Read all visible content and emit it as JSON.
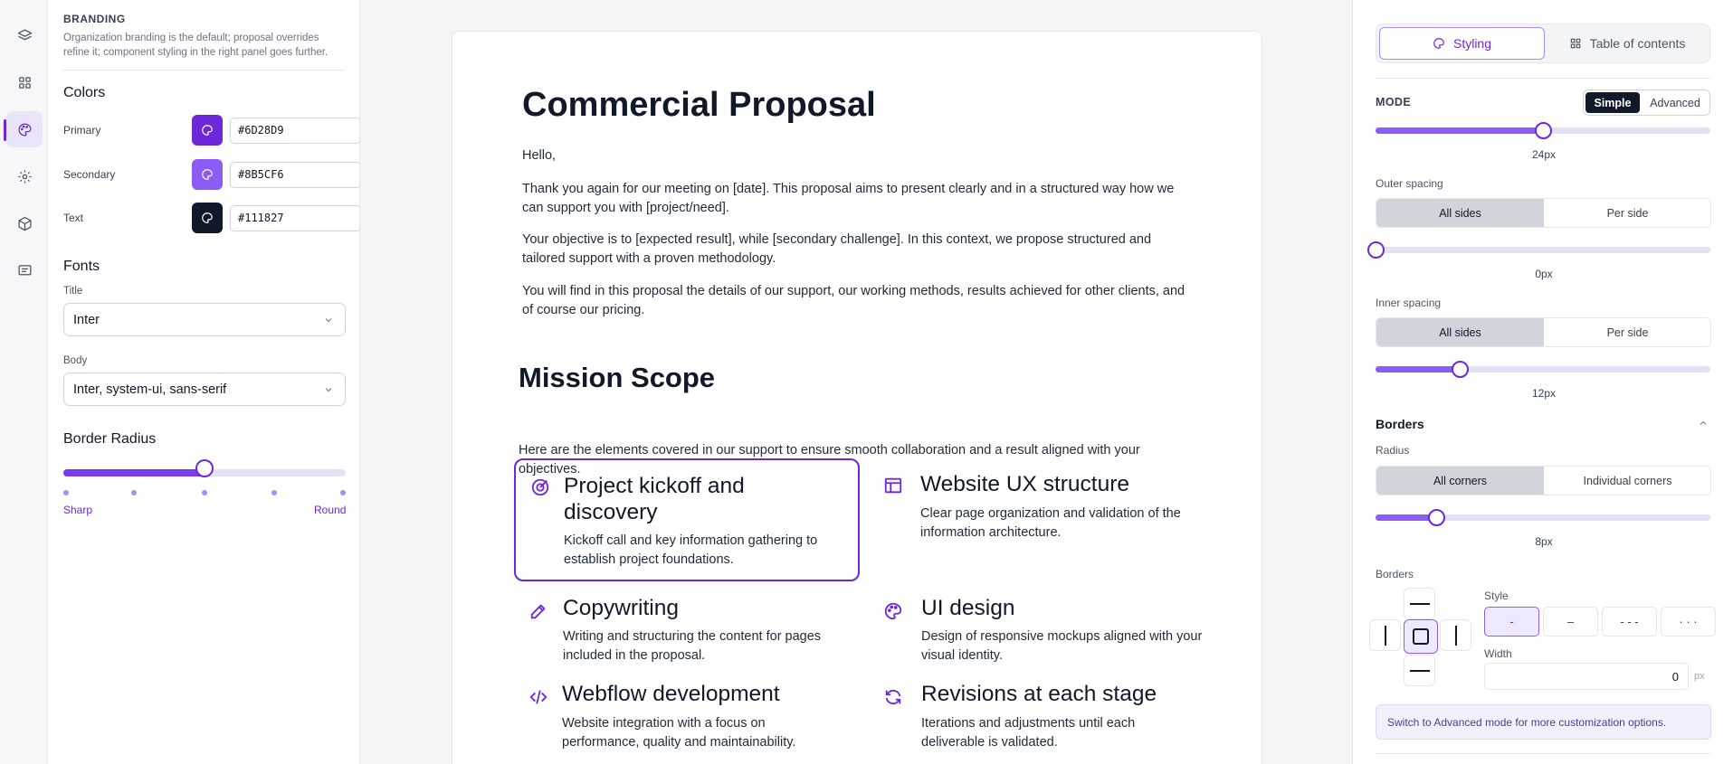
{
  "rail": {
    "items": [
      "layers-icon",
      "grid-icon",
      "palette-icon",
      "gear-icon",
      "box-icon",
      "message-icon"
    ],
    "active_index": 2
  },
  "branding": {
    "section_title": "BRANDING",
    "description": "Organization branding is the default; proposal overrides refine it; component styling in the right panel goes further.",
    "colors_heading": "Colors",
    "colors": [
      {
        "label": "Primary",
        "value": "#6D28D9"
      },
      {
        "label": "Secondary",
        "value": "#8B5CF6"
      },
      {
        "label": "Text",
        "value": "#111827"
      }
    ],
    "fonts_heading": "Fonts",
    "title_font_label": "Title",
    "title_font_value": "Inter",
    "body_font_label": "Body",
    "body_font_value": "Inter, system-ui, sans-serif",
    "radius_heading": "Border Radius",
    "radius_level": 0.5,
    "radius_min_label": "Sharp",
    "radius_max_label": "Round"
  },
  "document": {
    "title": "Commercial Proposal",
    "greeting": "Hello,",
    "paragraphs": [
      "Thank you again for our meeting on [date]. This proposal aims to present clearly and in a structured way how we can support you with [project/need].",
      "Your objective is to [expected result], while [secondary challenge]. In this context, we propose structured and tailored support with a proven methodology.",
      "You will find in this proposal the details of our support, our working methods, results achieved for other clients, and of course our pricing."
    ],
    "mission_title": "Mission Scope",
    "mission_desc": "Here are the elements covered in our support to ensure smooth collaboration and a result aligned with your objectives.",
    "cards": [
      {
        "icon": "target-icon",
        "title": "Project kickoff and discovery",
        "desc": "Kickoff call and key information gathering to establish project foundations.",
        "selected": true
      },
      {
        "icon": "layout-icon",
        "title": "Website UX structure",
        "desc": "Clear page organization and validation of the information architecture."
      },
      {
        "icon": "pencil-icon",
        "title": "Copywriting",
        "desc": "Writing and structuring the content for pages included in the proposal."
      },
      {
        "icon": "palette-icon",
        "title": "UI design",
        "desc": "Design of responsive mockups aligned with your visual identity."
      },
      {
        "icon": "code-icon",
        "title": "Webflow development",
        "desc": "Website integration with a focus on performance, quality and maintainability."
      },
      {
        "icon": "refresh-icon",
        "title": "Revisions at each stage",
        "desc": "Iterations and adjustments until each deliverable is validated."
      }
    ]
  },
  "styling": {
    "tabs": [
      "Styling",
      "Table of contents"
    ],
    "mode_label": "MODE",
    "mode_options": [
      "Simple",
      "Advanced"
    ],
    "top_slider_value": "24px",
    "top_slider_level": 0.5,
    "outer_spacing_label": "Outer spacing",
    "spacing_options": [
      "All sides",
      "Per side"
    ],
    "outer_value": "0px",
    "outer_level": 0.0,
    "inner_spacing_label": "Inner spacing",
    "inner_value": "12px",
    "inner_level": 0.25,
    "borders_heading": "Borders",
    "radius_label": "Radius",
    "radius_options": [
      "All corners",
      "Individual corners"
    ],
    "radius_value": "8px",
    "radius_level": 0.18,
    "borders_label": "Borders",
    "style_label": "Style",
    "style_options": [
      "-",
      "–",
      "- - -",
      "· · ·"
    ],
    "width_label": "Width",
    "width_value": "0",
    "width_unit": "px",
    "info_text": "Switch to Advanced mode for more customization options."
  }
}
